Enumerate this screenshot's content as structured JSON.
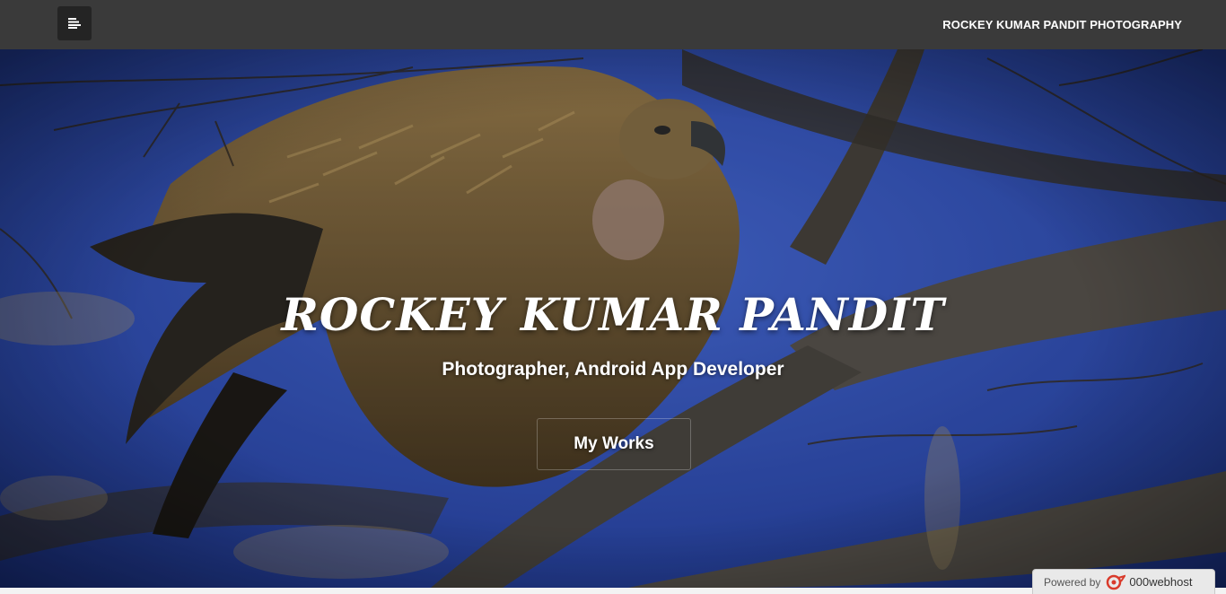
{
  "header": {
    "menu_icon": "menu-lines-icon",
    "site_title": "ROCKEY KUMAR PANDIT PHOTOGRAPHY"
  },
  "hero": {
    "name": "ROCKEY KUMAR PANDIT",
    "subtitle": "Photographer, Android App Developer",
    "button_label": "My Works",
    "background_image": "vulture perched on tree branches against blue sky"
  },
  "footer_badge": {
    "prefix": "Powered by",
    "host": "000webhost",
    "logo_icon": "000webhost-logo-icon"
  },
  "colors": {
    "topbar": "#3a3a3a",
    "menu_button": "#242424",
    "sky": "#3458c8",
    "text": "#ffffff"
  }
}
